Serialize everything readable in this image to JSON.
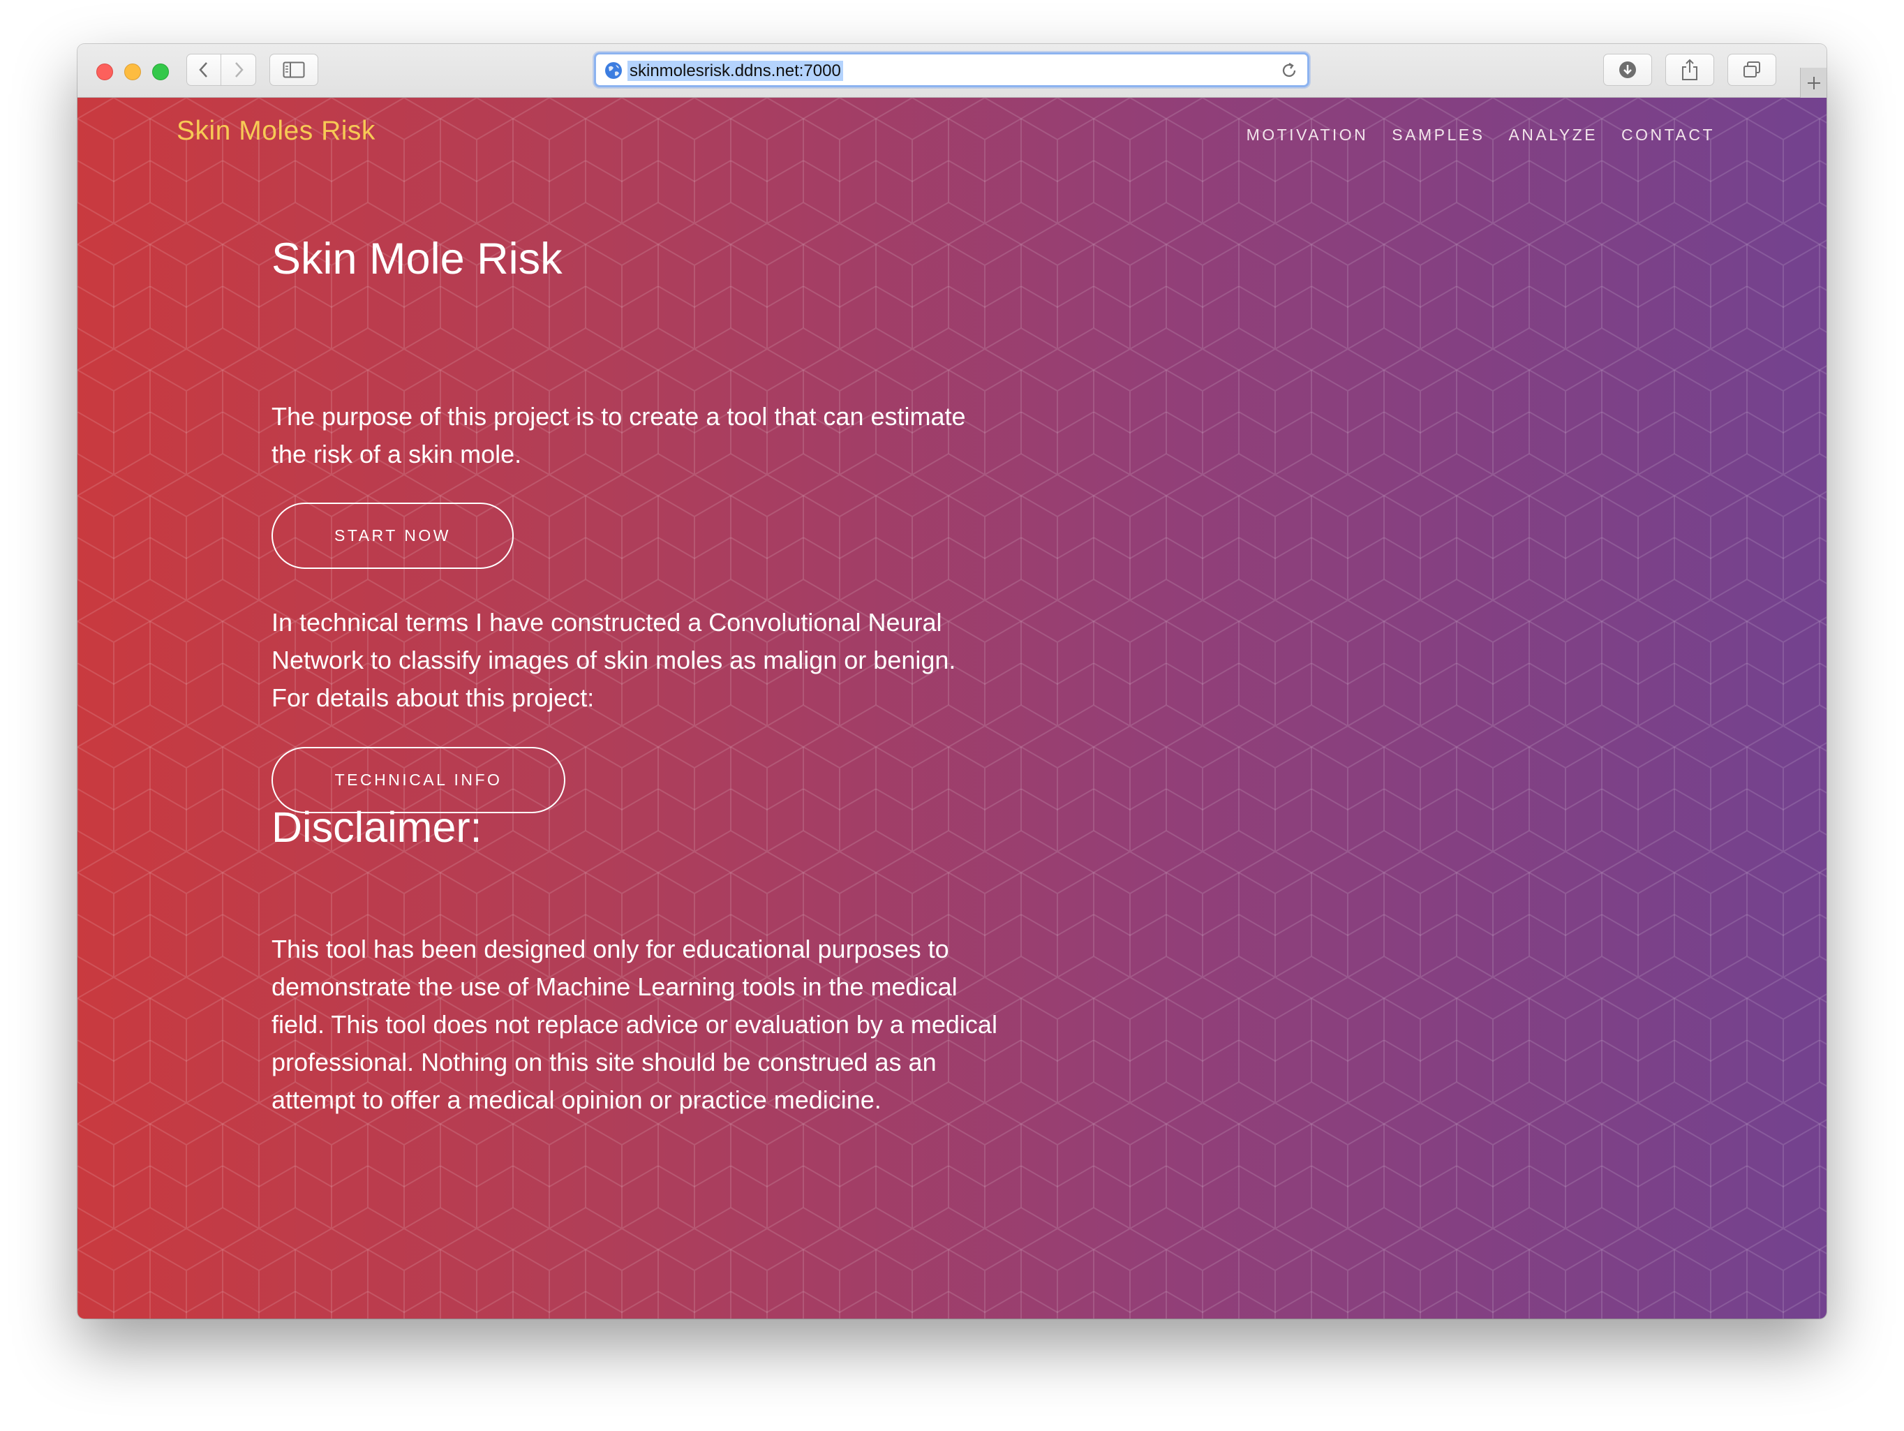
{
  "browser": {
    "url": "skinmolesrisk.ddns.net:7000"
  },
  "header": {
    "brand": "Skin Moles Risk",
    "nav": [
      {
        "label": "MOTIVATION"
      },
      {
        "label": "SAMPLES"
      },
      {
        "label": "ANALYZE"
      },
      {
        "label": "CONTACT"
      }
    ]
  },
  "hero": {
    "title": "Skin Mole Risk",
    "purpose": "The purpose of this project is to create a tool that can estimate the risk of a skin mole.",
    "start_button": "START NOW",
    "technical_text": "In technical terms I have constructed a Convolutional Neural Network to classify images of skin moles as malign or benign. For details about this project:",
    "tech_button": "TECHNICAL INFO",
    "disclaimer_title": "Disclaimer:",
    "disclaimer_text": "This tool has been designed only for educational purposes to demonstrate the use of Machine Learning tools in the medical field. This tool does not replace advice or evaluation by a medical professional. Nothing on this site should be construed as an attempt to offer a medical opinion or practice medicine."
  },
  "colors": {
    "gradient_left": "#c93a3f",
    "gradient_right": "#73428f",
    "brand": "#f7ca55",
    "url_highlight": "#b4d3fd"
  },
  "icons": [
    "close-light",
    "minimize-light",
    "zoom-light",
    "back-icon",
    "forward-icon",
    "sidebar-icon",
    "globe-icon",
    "reload-icon",
    "download-icon",
    "share-icon",
    "tabs-icon",
    "plus-icon"
  ]
}
